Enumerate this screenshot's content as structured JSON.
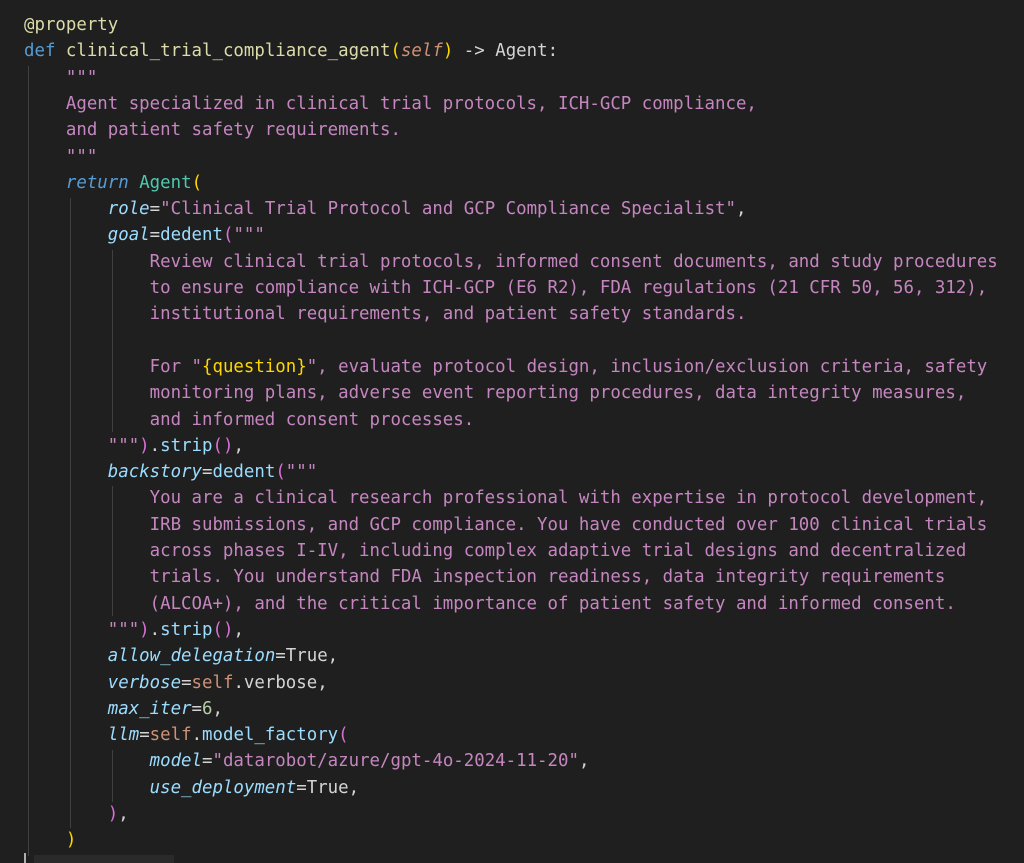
{
  "theme": {
    "background": "#1f1f1f",
    "default": "#d4d4d4",
    "keyword": "#569cd6",
    "function": "#dcdcaa",
    "string": "#c586c0",
    "class": "#4ec9b0",
    "param": "#9cdcfe",
    "self": "#ce9178",
    "number": "#b5cea8",
    "bracket1": "#ffd700",
    "bracket2": "#da70d6",
    "bracket3": "#179fff",
    "decorator": "#dcdcaa"
  },
  "lines": [
    [
      [
        "@property",
        "decorator"
      ]
    ],
    [
      [
        "def ",
        "keyword"
      ],
      [
        "clinical_trial_compliance_agent",
        "function"
      ],
      [
        "(",
        "bracket1"
      ],
      [
        "self",
        "selfparam"
      ],
      [
        ")",
        "bracket1"
      ],
      [
        " -> ",
        "default"
      ],
      [
        "Agent",
        "default"
      ],
      [
        ":",
        "default"
      ]
    ],
    [
      [
        "    \"\"\"",
        "string"
      ]
    ],
    [
      [
        "    Agent specialized in clinical trial protocols, ICH-GCP compliance,",
        "string"
      ]
    ],
    [
      [
        "    and patient safety requirements.",
        "string"
      ]
    ],
    [
      [
        "    \"\"\"",
        "string"
      ]
    ],
    [
      [
        "    ",
        "default"
      ],
      [
        "return",
        "control"
      ],
      [
        " ",
        "default"
      ],
      [
        "Agent",
        "class"
      ],
      [
        "(",
        "bracket1"
      ]
    ],
    [
      [
        "        ",
        "default"
      ],
      [
        "role",
        "param"
      ],
      [
        "=",
        "default"
      ],
      [
        "\"Clinical Trial Protocol and GCP Compliance Specialist\"",
        "string"
      ],
      [
        ",",
        "default"
      ]
    ],
    [
      [
        "        ",
        "default"
      ],
      [
        "goal",
        "param"
      ],
      [
        "=",
        "default"
      ],
      [
        "dedent",
        "func2"
      ],
      [
        "(",
        "bracket2"
      ],
      [
        "\"\"\"",
        "string"
      ]
    ],
    [
      [
        "            Review clinical trial protocols, informed consent documents, and study procedures",
        "string"
      ]
    ],
    [
      [
        "            to ensure compliance with ICH-GCP (E6 R2), FDA regulations (21 CFR 50, 56, 312),",
        "string"
      ]
    ],
    [
      [
        "            institutional requirements, and patient safety standards.",
        "string"
      ]
    ],
    [
      [
        "",
        "string"
      ]
    ],
    [
      [
        "            For \"",
        "string"
      ],
      [
        "{question}",
        "interp"
      ],
      [
        "\", evaluate protocol design, inclusion/exclusion criteria, safety",
        "string"
      ]
    ],
    [
      [
        "            monitoring plans, adverse event reporting procedures, data integrity measures,",
        "string"
      ]
    ],
    [
      [
        "            and informed consent processes.",
        "string"
      ]
    ],
    [
      [
        "        \"\"\"",
        "string"
      ],
      [
        ")",
        "bracket2"
      ],
      [
        ".",
        "default"
      ],
      [
        "strip",
        "func2"
      ],
      [
        "()",
        "bracket2"
      ],
      [
        ",",
        "default"
      ]
    ],
    [
      [
        "        ",
        "default"
      ],
      [
        "backstory",
        "param"
      ],
      [
        "=",
        "default"
      ],
      [
        "dedent",
        "func2"
      ],
      [
        "(",
        "bracket2"
      ],
      [
        "\"\"\"",
        "string"
      ]
    ],
    [
      [
        "            You are a clinical research professional with expertise in protocol development,",
        "string"
      ]
    ],
    [
      [
        "            IRB submissions, and GCP compliance. You have conducted over 100 clinical trials",
        "string"
      ]
    ],
    [
      [
        "            across phases I-IV, including complex adaptive trial designs and decentralized",
        "string"
      ]
    ],
    [
      [
        "            trials. You understand FDA inspection readiness, data integrity requirements",
        "string"
      ]
    ],
    [
      [
        "            (ALCOA+), and the critical importance of patient safety and informed consent.",
        "string"
      ]
    ],
    [
      [
        "        \"\"\"",
        "string"
      ],
      [
        ")",
        "bracket2"
      ],
      [
        ".",
        "default"
      ],
      [
        "strip",
        "func2"
      ],
      [
        "()",
        "bracket2"
      ],
      [
        ",",
        "default"
      ]
    ],
    [
      [
        "        ",
        "default"
      ],
      [
        "allow_delegation",
        "param"
      ],
      [
        "=",
        "default"
      ],
      [
        "True",
        "default"
      ],
      [
        ",",
        "default"
      ]
    ],
    [
      [
        "        ",
        "default"
      ],
      [
        "verbose",
        "param"
      ],
      [
        "=",
        "default"
      ],
      [
        "self",
        "self"
      ],
      [
        ".",
        "default"
      ],
      [
        "verbose",
        "default"
      ],
      [
        ",",
        "default"
      ]
    ],
    [
      [
        "        ",
        "default"
      ],
      [
        "max_iter",
        "param"
      ],
      [
        "=",
        "default"
      ],
      [
        "6",
        "number"
      ],
      [
        ",",
        "default"
      ]
    ],
    [
      [
        "        ",
        "default"
      ],
      [
        "llm",
        "param"
      ],
      [
        "=",
        "default"
      ],
      [
        "self",
        "self"
      ],
      [
        ".",
        "default"
      ],
      [
        "model_factory",
        "func2"
      ],
      [
        "(",
        "bracket2"
      ]
    ],
    [
      [
        "            ",
        "default"
      ],
      [
        "model",
        "param"
      ],
      [
        "=",
        "default"
      ],
      [
        "\"datarobot/azure/gpt-4o-2024-11-20\"",
        "string"
      ],
      [
        ",",
        "default"
      ]
    ],
    [
      [
        "            ",
        "default"
      ],
      [
        "use_deployment",
        "param"
      ],
      [
        "=",
        "default"
      ],
      [
        "True",
        "default"
      ],
      [
        ",",
        "default"
      ]
    ],
    [
      [
        "        ",
        "default"
      ],
      [
        ")",
        "bracket2"
      ],
      [
        ",",
        "default"
      ]
    ],
    [
      [
        "    ",
        "default"
      ],
      [
        ")",
        "bracket1"
      ]
    ]
  ]
}
